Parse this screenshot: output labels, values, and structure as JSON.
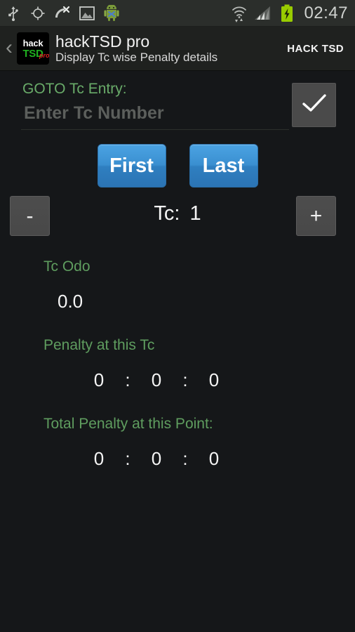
{
  "statusbar": {
    "icons_left": [
      "usb-icon",
      "gps-crosshair-icon",
      "gps-off-satellite-icon",
      "screenshot-image-icon",
      "android-mascot-icon"
    ],
    "icons_right": [
      "wifi-transfer-icon",
      "cellular-signal-icon",
      "battery-charging-icon"
    ],
    "clock": "02:47"
  },
  "actionbar": {
    "back_label": "‹",
    "logo": {
      "line1": "hack",
      "line2": "TSD",
      "badge": "pro"
    },
    "title": "hackTSD pro",
    "subtitle": "Display Tc wise Penalty details",
    "action_label": "HACK TSD"
  },
  "goto": {
    "label": "GOTO Tc Entry:",
    "input_value": "",
    "input_placeholder": "Enter Tc Number",
    "confirm_icon": "checkmark-icon"
  },
  "nav": {
    "first_label": "First",
    "last_label": "Last"
  },
  "stepper": {
    "minus_label": "-",
    "plus_label": "+",
    "tc_label": "Tc:",
    "tc_number": "1"
  },
  "odo": {
    "label": "Tc Odo",
    "value": "0.0"
  },
  "penalty_tc": {
    "label": "Penalty at this Tc",
    "h": "0",
    "sep1": ":",
    "m": "0",
    "sep2": ":",
    "s": "0"
  },
  "penalty_total": {
    "label": "Total Penalty at this Point:",
    "h": "0",
    "sep1": ":",
    "m": "0",
    "sep2": ":",
    "s": "0"
  },
  "colors": {
    "background": "#151719",
    "accent_green": "#5f9d5f",
    "button_blue": "#3a8fd0",
    "battery_green": "#99cc00",
    "logo_green": "#1faf1f",
    "logo_red": "#e02020"
  }
}
